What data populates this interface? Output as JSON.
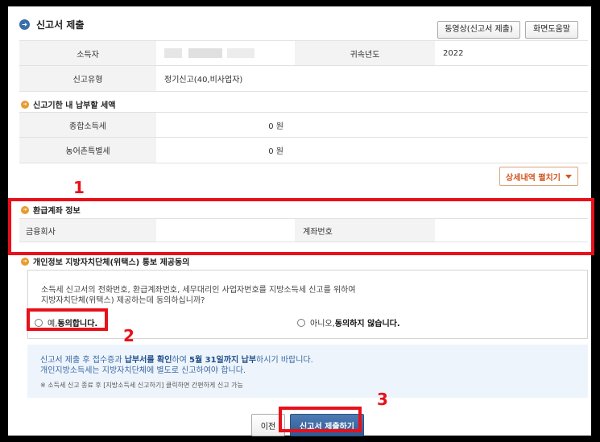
{
  "header": {
    "title": "신고서 제출",
    "icon": "arrow-right-icon"
  },
  "toolbar": {
    "video_label": "동영상(신고서 제출)",
    "help_label": "화면도움말"
  },
  "info": {
    "taxpayer_label": "소득자",
    "year_label": "귀속년도",
    "year_value": "2022",
    "type_label": "신고유형",
    "type_value": "정기신고(40,비사업자)"
  },
  "payment": {
    "title": "신고기한 내 납부할 세액",
    "income_tax_label": "종합소득세",
    "income_tax_value": "0 원",
    "rural_tax_label": "농어촌특별세",
    "rural_tax_value": "0 원",
    "detail_label": "상세내역 펼치기"
  },
  "refund": {
    "title": "환급계좌 정보",
    "bank_label": "금융회사",
    "account_label": "계좌번호"
  },
  "consent": {
    "title": "개인정보 지방자치단체(위택스) 통보 제공동의",
    "text_line1": "소득세 신고서의 전화번호, 환급계좌번호, 세무대리인 사업자번호를 지방소득세 신고를 위하여",
    "text_line2": "지방자치단체(위택스) 제공하는데 동의하십니까?",
    "yes_prefix": "예, ",
    "yes_bold": "동의합니다.",
    "no_prefix": "아니오, ",
    "no_bold": "동의하지 않습니다."
  },
  "notice": {
    "line1_a": "신고서 제출 후 접수증과 ",
    "line1_b": "납부서를 확인",
    "line1_c": "하여 ",
    "line1_d": "5월 31일까지 납부",
    "line1_e": "하시기 바랍니다.",
    "line2": "개인지방소득세는 지방자치단체에 별도로 신고하여야 합니다.",
    "line3": "※ 소득세 신고 종료 후 [지방소득세 신고하기] 클릭하면 간편하게 신고 가능"
  },
  "buttons": {
    "prev_label": "이전",
    "submit_label": "신고서 제출하기"
  },
  "annotations": {
    "n1": "1",
    "n2": "2",
    "n3": "3"
  },
  "colors": {
    "highlight": "#e8101a",
    "primary": "#2d5b95",
    "accent": "#d0541e"
  }
}
